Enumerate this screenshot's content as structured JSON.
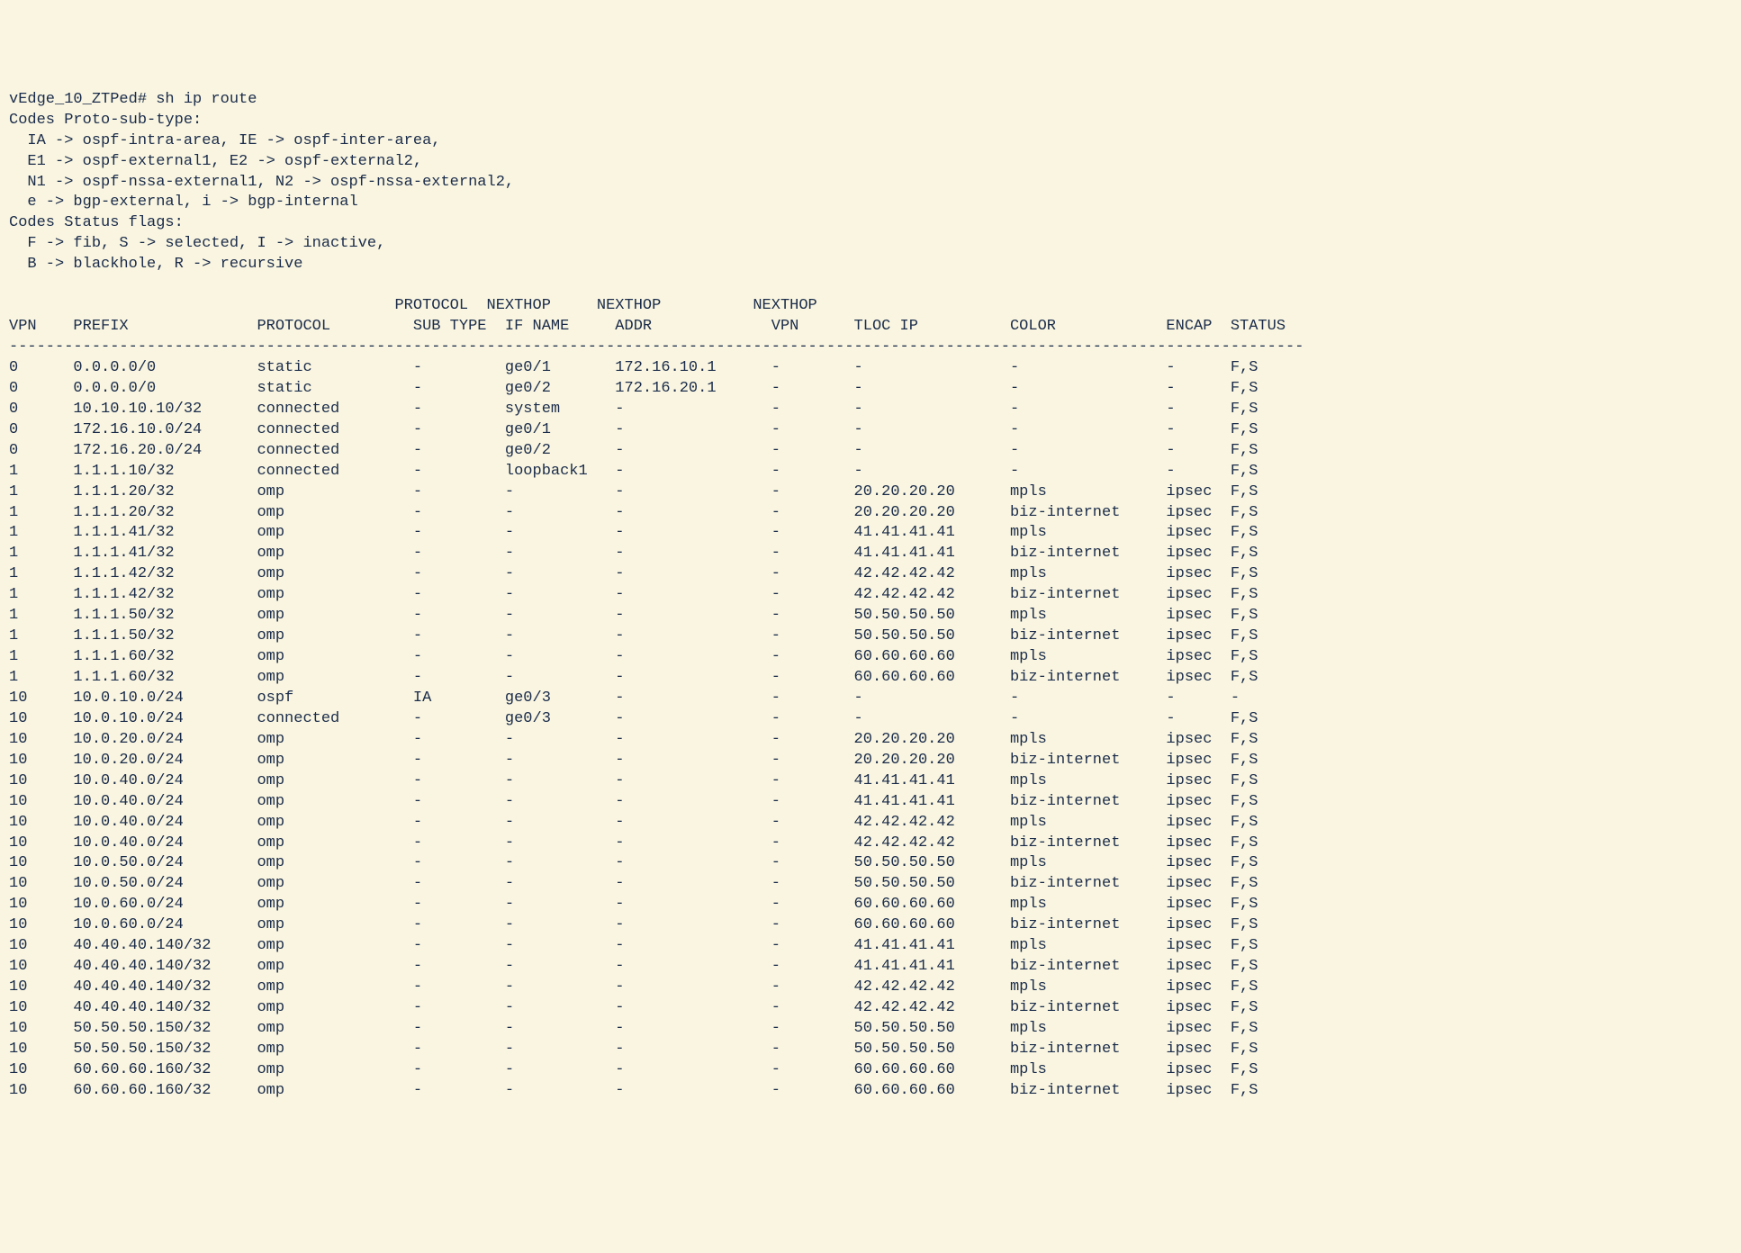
{
  "prompt_line": "vEdge_10_ZTPed# sh ip route",
  "codes_proto_header": "Codes Proto-sub-type:",
  "codes_proto_lines": [
    "  IA -> ospf-intra-area, IE -> ospf-inter-area,",
    "  E1 -> ospf-external1, E2 -> ospf-external2,",
    "  N1 -> ospf-nssa-external1, N2 -> ospf-nssa-external2,",
    "  e -> bgp-external, i -> bgp-internal"
  ],
  "codes_status_header": "Codes Status flags:",
  "codes_status_lines": [
    "  F -> fib, S -> selected, I -> inactive,",
    "  B -> blackhole, R -> recursive"
  ],
  "table_header1": "                                          PROTOCOL  NEXTHOP     NEXTHOP          NEXTHOP",
  "table_header2": "VPN    PREFIX              PROTOCOL         SUB TYPE  IF NAME     ADDR             VPN      TLOC IP          COLOR            ENCAP  STATUS",
  "table_divider": "---------------------------------------------------------------------------------------------------------------------------------------------",
  "routes": [
    {
      "vpn": "0",
      "prefix": "0.0.0.0/0",
      "protocol": "static",
      "subtype": "-",
      "ifname": "ge0/1",
      "addr": "172.16.10.1",
      "nvpn": "-",
      "tloc": "-",
      "color": "-",
      "encap": "-",
      "status": "F,S"
    },
    {
      "vpn": "0",
      "prefix": "0.0.0.0/0",
      "protocol": "static",
      "subtype": "-",
      "ifname": "ge0/2",
      "addr": "172.16.20.1",
      "nvpn": "-",
      "tloc": "-",
      "color": "-",
      "encap": "-",
      "status": "F,S"
    },
    {
      "vpn": "0",
      "prefix": "10.10.10.10/32",
      "protocol": "connected",
      "subtype": "-",
      "ifname": "system",
      "addr": "-",
      "nvpn": "-",
      "tloc": "-",
      "color": "-",
      "encap": "-",
      "status": "F,S"
    },
    {
      "vpn": "0",
      "prefix": "172.16.10.0/24",
      "protocol": "connected",
      "subtype": "-",
      "ifname": "ge0/1",
      "addr": "-",
      "nvpn": "-",
      "tloc": "-",
      "color": "-",
      "encap": "-",
      "status": "F,S"
    },
    {
      "vpn": "0",
      "prefix": "172.16.20.0/24",
      "protocol": "connected",
      "subtype": "-",
      "ifname": "ge0/2",
      "addr": "-",
      "nvpn": "-",
      "tloc": "-",
      "color": "-",
      "encap": "-",
      "status": "F,S"
    },
    {
      "vpn": "1",
      "prefix": "1.1.1.10/32",
      "protocol": "connected",
      "subtype": "-",
      "ifname": "loopback1",
      "addr": "-",
      "nvpn": "-",
      "tloc": "-",
      "color": "-",
      "encap": "-",
      "status": "F,S"
    },
    {
      "vpn": "1",
      "prefix": "1.1.1.20/32",
      "protocol": "omp",
      "subtype": "-",
      "ifname": "-",
      "addr": "-",
      "nvpn": "-",
      "tloc": "20.20.20.20",
      "color": "mpls",
      "encap": "ipsec",
      "status": "F,S"
    },
    {
      "vpn": "1",
      "prefix": "1.1.1.20/32",
      "protocol": "omp",
      "subtype": "-",
      "ifname": "-",
      "addr": "-",
      "nvpn": "-",
      "tloc": "20.20.20.20",
      "color": "biz-internet",
      "encap": "ipsec",
      "status": "F,S"
    },
    {
      "vpn": "1",
      "prefix": "1.1.1.41/32",
      "protocol": "omp",
      "subtype": "-",
      "ifname": "-",
      "addr": "-",
      "nvpn": "-",
      "tloc": "41.41.41.41",
      "color": "mpls",
      "encap": "ipsec",
      "status": "F,S"
    },
    {
      "vpn": "1",
      "prefix": "1.1.1.41/32",
      "protocol": "omp",
      "subtype": "-",
      "ifname": "-",
      "addr": "-",
      "nvpn": "-",
      "tloc": "41.41.41.41",
      "color": "biz-internet",
      "encap": "ipsec",
      "status": "F,S"
    },
    {
      "vpn": "1",
      "prefix": "1.1.1.42/32",
      "protocol": "omp",
      "subtype": "-",
      "ifname": "-",
      "addr": "-",
      "nvpn": "-",
      "tloc": "42.42.42.42",
      "color": "mpls",
      "encap": "ipsec",
      "status": "F,S"
    },
    {
      "vpn": "1",
      "prefix": "1.1.1.42/32",
      "protocol": "omp",
      "subtype": "-",
      "ifname": "-",
      "addr": "-",
      "nvpn": "-",
      "tloc": "42.42.42.42",
      "color": "biz-internet",
      "encap": "ipsec",
      "status": "F,S"
    },
    {
      "vpn": "1",
      "prefix": "1.1.1.50/32",
      "protocol": "omp",
      "subtype": "-",
      "ifname": "-",
      "addr": "-",
      "nvpn": "-",
      "tloc": "50.50.50.50",
      "color": "mpls",
      "encap": "ipsec",
      "status": "F,S"
    },
    {
      "vpn": "1",
      "prefix": "1.1.1.50/32",
      "protocol": "omp",
      "subtype": "-",
      "ifname": "-",
      "addr": "-",
      "nvpn": "-",
      "tloc": "50.50.50.50",
      "color": "biz-internet",
      "encap": "ipsec",
      "status": "F,S"
    },
    {
      "vpn": "1",
      "prefix": "1.1.1.60/32",
      "protocol": "omp",
      "subtype": "-",
      "ifname": "-",
      "addr": "-",
      "nvpn": "-",
      "tloc": "60.60.60.60",
      "color": "mpls",
      "encap": "ipsec",
      "status": "F,S"
    },
    {
      "vpn": "1",
      "prefix": "1.1.1.60/32",
      "protocol": "omp",
      "subtype": "-",
      "ifname": "-",
      "addr": "-",
      "nvpn": "-",
      "tloc": "60.60.60.60",
      "color": "biz-internet",
      "encap": "ipsec",
      "status": "F,S"
    },
    {
      "vpn": "10",
      "prefix": "10.0.10.0/24",
      "protocol": "ospf",
      "subtype": "IA",
      "ifname": "ge0/3",
      "addr": "-",
      "nvpn": "-",
      "tloc": "-",
      "color": "-",
      "encap": "-",
      "status": "-"
    },
    {
      "vpn": "10",
      "prefix": "10.0.10.0/24",
      "protocol": "connected",
      "subtype": "-",
      "ifname": "ge0/3",
      "addr": "-",
      "nvpn": "-",
      "tloc": "-",
      "color": "-",
      "encap": "-",
      "status": "F,S"
    },
    {
      "vpn": "10",
      "prefix": "10.0.20.0/24",
      "protocol": "omp",
      "subtype": "-",
      "ifname": "-",
      "addr": "-",
      "nvpn": "-",
      "tloc": "20.20.20.20",
      "color": "mpls",
      "encap": "ipsec",
      "status": "F,S"
    },
    {
      "vpn": "10",
      "prefix": "10.0.20.0/24",
      "protocol": "omp",
      "subtype": "-",
      "ifname": "-",
      "addr": "-",
      "nvpn": "-",
      "tloc": "20.20.20.20",
      "color": "biz-internet",
      "encap": "ipsec",
      "status": "F,S"
    },
    {
      "vpn": "10",
      "prefix": "10.0.40.0/24",
      "protocol": "omp",
      "subtype": "-",
      "ifname": "-",
      "addr": "-",
      "nvpn": "-",
      "tloc": "41.41.41.41",
      "color": "mpls",
      "encap": "ipsec",
      "status": "F,S"
    },
    {
      "vpn": "10",
      "prefix": "10.0.40.0/24",
      "protocol": "omp",
      "subtype": "-",
      "ifname": "-",
      "addr": "-",
      "nvpn": "-",
      "tloc": "41.41.41.41",
      "color": "biz-internet",
      "encap": "ipsec",
      "status": "F,S"
    },
    {
      "vpn": "10",
      "prefix": "10.0.40.0/24",
      "protocol": "omp",
      "subtype": "-",
      "ifname": "-",
      "addr": "-",
      "nvpn": "-",
      "tloc": "42.42.42.42",
      "color": "mpls",
      "encap": "ipsec",
      "status": "F,S"
    },
    {
      "vpn": "10",
      "prefix": "10.0.40.0/24",
      "protocol": "omp",
      "subtype": "-",
      "ifname": "-",
      "addr": "-",
      "nvpn": "-",
      "tloc": "42.42.42.42",
      "color": "biz-internet",
      "encap": "ipsec",
      "status": "F,S"
    },
    {
      "vpn": "10",
      "prefix": "10.0.50.0/24",
      "protocol": "omp",
      "subtype": "-",
      "ifname": "-",
      "addr": "-",
      "nvpn": "-",
      "tloc": "50.50.50.50",
      "color": "mpls",
      "encap": "ipsec",
      "status": "F,S"
    },
    {
      "vpn": "10",
      "prefix": "10.0.50.0/24",
      "protocol": "omp",
      "subtype": "-",
      "ifname": "-",
      "addr": "-",
      "nvpn": "-",
      "tloc": "50.50.50.50",
      "color": "biz-internet",
      "encap": "ipsec",
      "status": "F,S"
    },
    {
      "vpn": "10",
      "prefix": "10.0.60.0/24",
      "protocol": "omp",
      "subtype": "-",
      "ifname": "-",
      "addr": "-",
      "nvpn": "-",
      "tloc": "60.60.60.60",
      "color": "mpls",
      "encap": "ipsec",
      "status": "F,S"
    },
    {
      "vpn": "10",
      "prefix": "10.0.60.0/24",
      "protocol": "omp",
      "subtype": "-",
      "ifname": "-",
      "addr": "-",
      "nvpn": "-",
      "tloc": "60.60.60.60",
      "color": "biz-internet",
      "encap": "ipsec",
      "status": "F,S"
    },
    {
      "vpn": "10",
      "prefix": "40.40.40.140/32",
      "protocol": "omp",
      "subtype": "-",
      "ifname": "-",
      "addr": "-",
      "nvpn": "-",
      "tloc": "41.41.41.41",
      "color": "mpls",
      "encap": "ipsec",
      "status": "F,S"
    },
    {
      "vpn": "10",
      "prefix": "40.40.40.140/32",
      "protocol": "omp",
      "subtype": "-",
      "ifname": "-",
      "addr": "-",
      "nvpn": "-",
      "tloc": "41.41.41.41",
      "color": "biz-internet",
      "encap": "ipsec",
      "status": "F,S"
    },
    {
      "vpn": "10",
      "prefix": "40.40.40.140/32",
      "protocol": "omp",
      "subtype": "-",
      "ifname": "-",
      "addr": "-",
      "nvpn": "-",
      "tloc": "42.42.42.42",
      "color": "mpls",
      "encap": "ipsec",
      "status": "F,S"
    },
    {
      "vpn": "10",
      "prefix": "40.40.40.140/32",
      "protocol": "omp",
      "subtype": "-",
      "ifname": "-",
      "addr": "-",
      "nvpn": "-",
      "tloc": "42.42.42.42",
      "color": "biz-internet",
      "encap": "ipsec",
      "status": "F,S"
    },
    {
      "vpn": "10",
      "prefix": "50.50.50.150/32",
      "protocol": "omp",
      "subtype": "-",
      "ifname": "-",
      "addr": "-",
      "nvpn": "-",
      "tloc": "50.50.50.50",
      "color": "mpls",
      "encap": "ipsec",
      "status": "F,S"
    },
    {
      "vpn": "10",
      "prefix": "50.50.50.150/32",
      "protocol": "omp",
      "subtype": "-",
      "ifname": "-",
      "addr": "-",
      "nvpn": "-",
      "tloc": "50.50.50.50",
      "color": "biz-internet",
      "encap": "ipsec",
      "status": "F,S"
    },
    {
      "vpn": "10",
      "prefix": "60.60.60.160/32",
      "protocol": "omp",
      "subtype": "-",
      "ifname": "-",
      "addr": "-",
      "nvpn": "-",
      "tloc": "60.60.60.60",
      "color": "mpls",
      "encap": "ipsec",
      "status": "F,S"
    },
    {
      "vpn": "10",
      "prefix": "60.60.60.160/32",
      "protocol": "omp",
      "subtype": "-",
      "ifname": "-",
      "addr": "-",
      "nvpn": "-",
      "tloc": "60.60.60.60",
      "color": "biz-internet",
      "encap": "ipsec",
      "status": "F,S"
    }
  ]
}
